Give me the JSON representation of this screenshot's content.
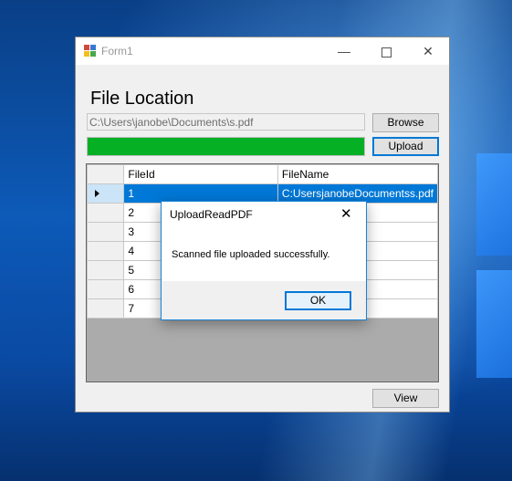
{
  "window": {
    "title": "Form1"
  },
  "form": {
    "heading": "File Location",
    "path_value": "C:\\Users\\janobe\\Documents\\s.pdf",
    "browse_label": "Browse",
    "upload_label": "Upload",
    "view_label": "View",
    "progress_fraction": 1.0
  },
  "grid": {
    "columns": [
      "FileId",
      "FileName"
    ],
    "rows": [
      {
        "id": "1",
        "name": "C:UsersjanobeDocumentss.pdf",
        "selected": true
      },
      {
        "id": "2",
        "name": ""
      },
      {
        "id": "3",
        "name": ""
      },
      {
        "id": "4",
        "name": ""
      },
      {
        "id": "5",
        "name": ""
      },
      {
        "id": "6",
        "name": ""
      },
      {
        "id": "7",
        "name": ""
      }
    ]
  },
  "dialog": {
    "title": "UploadReadPDF",
    "message": "Scanned file uploaded successfully.",
    "ok_label": "OK"
  },
  "colors": {
    "progress": "#06b025",
    "selection": "#0078d7",
    "accent_border": "#0078d7"
  },
  "icons": {
    "app": "form-app-icon",
    "close": "close-icon",
    "minimize": "minimize-icon",
    "maximize": "maximize-icon",
    "row_indicator": "row-pointer-icon"
  }
}
